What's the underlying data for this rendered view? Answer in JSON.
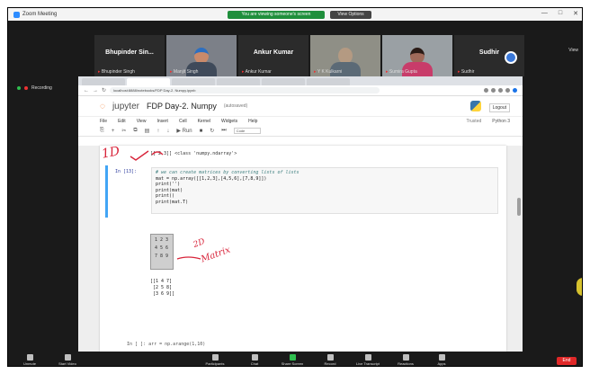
{
  "zoom": {
    "title": "Zoom Meeting",
    "share_notice": "You are viewing someone's screen",
    "view_options": "View Options",
    "controls": [
      "—",
      "□",
      "✕"
    ],
    "right_label": "View",
    "participants": [
      {
        "name": "Bhupinder Sin...",
        "label": "Bhupinder Singh",
        "video": false
      },
      {
        "name": "",
        "label": "Manjit Singh",
        "video": true,
        "color": "#c98a6b"
      },
      {
        "name": "Ankur Kumar",
        "label": "Ankur Kumar",
        "video": false
      },
      {
        "name": "",
        "label": "Y K Kulkarni",
        "video": true,
        "color": "#b49a82"
      },
      {
        "name": "",
        "label": "Sumira Gupta",
        "video": true,
        "color": "#a06a5a"
      },
      {
        "name": "Sudhir",
        "label": "Sudhir",
        "video": false
      }
    ],
    "side_label": "Recording",
    "bottom_controls": [
      {
        "label": "Unmute",
        "icon": "mic-icon"
      },
      {
        "label": "Start Video",
        "icon": "video-icon"
      },
      {
        "label": "Participants",
        "icon": "participants-icon"
      },
      {
        "label": "Chat",
        "icon": "chat-icon"
      },
      {
        "label": "Share Screen",
        "icon": "share-icon",
        "green": true
      },
      {
        "label": "Record",
        "icon": "record-icon"
      },
      {
        "label": "Live Transcript",
        "icon": "cc-icon"
      },
      {
        "label": "Reactions",
        "icon": "reaction-icon"
      },
      {
        "label": "Apps",
        "icon": "apps-icon"
      }
    ],
    "end_label": "End"
  },
  "browser": {
    "url": "localhost:8888/notebooks/FDP Day-2. Numpy.ipynb"
  },
  "jupyter": {
    "logo_text": "jupyter",
    "notebook_name": "FDP Day-2. Numpy",
    "save_status": "(autosaved)",
    "logout": "Logout",
    "menu": [
      "File",
      "Edit",
      "View",
      "Insert",
      "Cell",
      "Kernel",
      "Widgets",
      "Help"
    ],
    "trusted": "Trusted",
    "kernel": "Python 3",
    "toolbar": [
      "⎘",
      "+",
      "✂",
      "⧉",
      "▤",
      "↑",
      "↓",
      "▶ Run",
      "■",
      "↻",
      "⏭"
    ],
    "cell_type": "Code"
  },
  "notebook": {
    "prev_output": "[[ 2 3]]  <class 'numpy.ndarray'>",
    "cell_prompt": "In [13]:",
    "code_lines": [
      "# we can create matrices by converting lists of lists",
      "mat = np.array([[1,2,3],[4,5,6],[7,8,9]])",
      "print('')",
      "print(mat)",
      "print()",
      "print(mat.T)"
    ],
    "matrix_rows": [
      "1 2 3",
      "4 5 6",
      "7 8 9"
    ],
    "transpose_rows": [
      "[[1 4 7]",
      " [2 5 8]",
      " [3 6 9]]"
    ],
    "next_cell": "In [ ]:  arr = np.arange(1,10)"
  },
  "annotations": {
    "a1": "1D",
    "a2": "2D",
    "a3": "Matrix"
  }
}
